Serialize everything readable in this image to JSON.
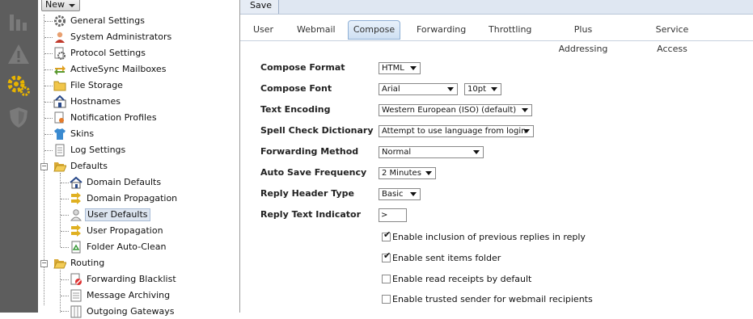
{
  "toolbar": {
    "new_label": "New",
    "save_label": "Save"
  },
  "rail": {
    "icons": [
      "reports-icon",
      "warning-icon",
      "settings-gear-icon",
      "security-shield-icon"
    ]
  },
  "tree": {
    "items": [
      {
        "label": "General Settings",
        "icon": "gear-icon"
      },
      {
        "label": "System Administrators",
        "icon": "admin-user-icon"
      },
      {
        "label": "Protocol Settings",
        "icon": "protocol-icon"
      },
      {
        "label": "ActiveSync Mailboxes",
        "icon": "sync-icon"
      },
      {
        "label": "File Storage",
        "icon": "folder-icon"
      },
      {
        "label": "Hostnames",
        "icon": "hostnames-icon"
      },
      {
        "label": "Notification Profiles",
        "icon": "notification-icon"
      },
      {
        "label": "Skins",
        "icon": "shirt-icon"
      },
      {
        "label": "Log Settings",
        "icon": "document-icon"
      },
      {
        "label": "Defaults",
        "icon": "folder-open-icon"
      },
      {
        "label": "Domain Defaults",
        "icon": "house-icon"
      },
      {
        "label": "Domain Propagation",
        "icon": "propagation-icon"
      },
      {
        "label": "User Defaults",
        "icon": "user-icon"
      },
      {
        "label": "User Propagation",
        "icon": "propagation-icon"
      },
      {
        "label": "Folder Auto-Clean",
        "icon": "recycle-icon"
      },
      {
        "label": "Routing",
        "icon": "folder-open-icon"
      },
      {
        "label": "Forwarding Blacklist",
        "icon": "blacklist-icon"
      },
      {
        "label": "Message Archiving",
        "icon": "archive-icon"
      },
      {
        "label": "Outgoing Gateways",
        "icon": "gateway-icon"
      }
    ]
  },
  "tabs": [
    "User",
    "Webmail",
    "Compose",
    "Forwarding",
    "Throttling",
    "Plus Addressing",
    "Service Access"
  ],
  "active_tab": "Compose",
  "form": {
    "compose_format": {
      "label": "Compose Format",
      "value": "HTML"
    },
    "compose_font": {
      "label": "Compose Font",
      "value": "Arial",
      "size": "10pt"
    },
    "text_encoding": {
      "label": "Text Encoding",
      "value": "Western European (ISO) (default)"
    },
    "spell_check": {
      "label": "Spell Check Dictionary",
      "value": "Attempt to use language from login"
    },
    "forwarding_method": {
      "label": "Forwarding Method",
      "value": "Normal"
    },
    "auto_save": {
      "label": "Auto Save Frequency",
      "value": "2 Minutes"
    },
    "reply_header": {
      "label": "Reply Header Type",
      "value": "Basic"
    },
    "reply_indicator": {
      "label": "Reply Text Indicator",
      "value": ">"
    }
  },
  "checkboxes": [
    {
      "label": "Enable inclusion of previous replies in reply",
      "checked": true
    },
    {
      "label": "Enable sent items folder",
      "checked": true
    },
    {
      "label": "Enable read receipts by default",
      "checked": false
    },
    {
      "label": "Enable trusted sender for webmail recipients",
      "checked": false
    }
  ],
  "colors": {
    "rail": "#5d5d5d",
    "accent": "#dfe7f2",
    "tab_active": "#cfe0f3",
    "gear": "#e8b400"
  }
}
